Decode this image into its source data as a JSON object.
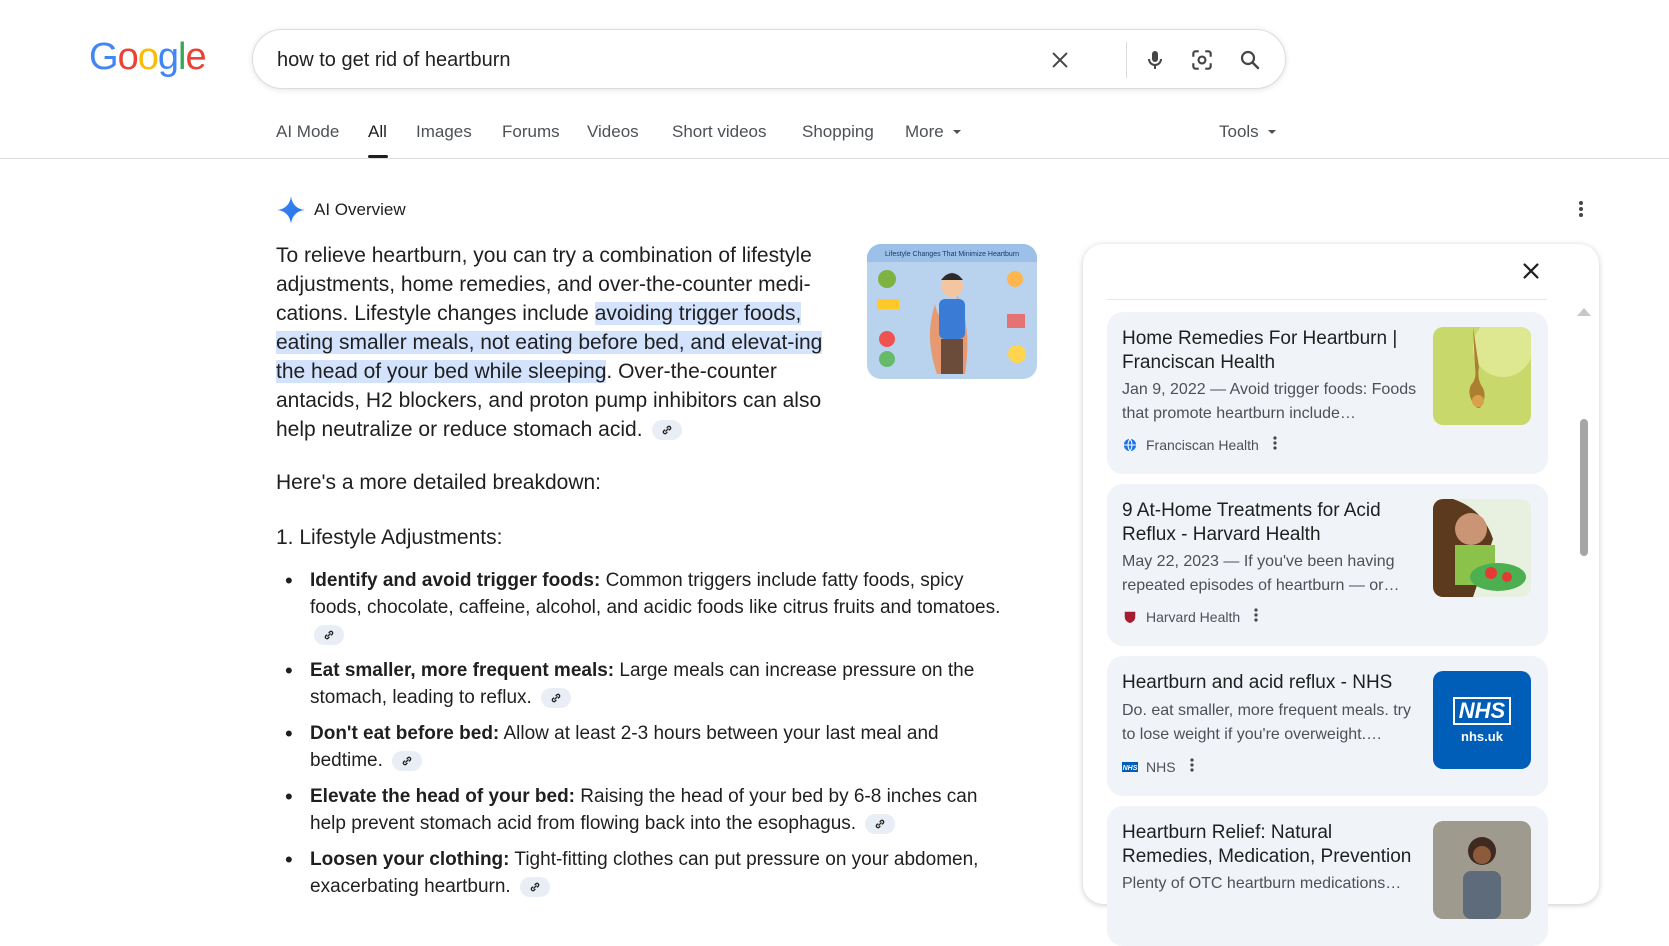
{
  "search": {
    "query": "how to get rid of heartburn"
  },
  "logo": {
    "letters": [
      "G",
      "o",
      "o",
      "g",
      "l",
      "e"
    ],
    "colors": [
      "#4285f4",
      "#ea4335",
      "#fbbc05",
      "#4285f4",
      "#34a853",
      "#ea4335"
    ]
  },
  "tabs": [
    {
      "label": "AI Mode"
    },
    {
      "label": "All"
    },
    {
      "label": "Images"
    },
    {
      "label": "Forums"
    },
    {
      "label": "Videos"
    },
    {
      "label": "Short videos"
    },
    {
      "label": "Shopping"
    },
    {
      "label": "More"
    }
  ],
  "tools_label": "Tools",
  "ai_overview": {
    "label": "AI Overview",
    "intro_1": "To relieve heartburn, you can try a combination of lifestyle adjustments, home remedies, and over-the-counter medi-cations. Lifestyle changes include ",
    "intro_highlight": "avoiding trigger foods, eating smaller meals, not eating before bed, and elevat-ing the head of your bed while sleeping",
    "intro_2": ". Over-the-counter antacids, H2 blockers, and proton pump inhibitors can also help neutralize or reduce stomach acid.",
    "image_caption": "Lifestyle Changes That Minimize Heartburn",
    "breakdown_heading": "Here's a more detailed breakdown:",
    "section_heading": "1. Lifestyle Adjustments:",
    "bullets": [
      {
        "bold": "Identify and avoid trigger foods:",
        "text": " Common triggers include fatty foods, spicy foods, chocolate, caffeine, alcohol, and acidic foods like citrus fruits and tomatoes."
      },
      {
        "bold": "Eat smaller, more frequent meals:",
        "text": " Large meals can increase pressure on the stomach, leading to reflux."
      },
      {
        "bold": "Don't eat before bed:",
        "text": " Allow at least 2-3 hours between your last meal and bedtime."
      },
      {
        "bold": "Elevate the head of your bed:",
        "text": " Raising the head of your bed by 6-8 inches can help prevent stomach acid from flowing back into the esophagus."
      },
      {
        "bold": "Loosen your clothing:",
        "text": " Tight-fitting clothes can put pressure on your abdomen, exacerbating heartburn."
      }
    ]
  },
  "sources": [
    {
      "title": "Home Remedies For Heartburn | Franciscan Health",
      "snippet": "Jan 9, 2022 — Avoid trigger foods: Foods that promote heartburn include…",
      "site": "Franciscan Health"
    },
    {
      "title": "9 At-Home Treatments for Acid Reflux - Harvard Health",
      "snippet": "May 22, 2023 — If you've been having repeated episodes of heartburn — or…",
      "site": "Harvard Health"
    },
    {
      "title": "Heartburn and acid reflux - NHS",
      "snippet": "Do. eat smaller, more frequent meals. try to lose weight if you're overweight.…",
      "site": "NHS",
      "thumb_logo": "NHS",
      "thumb_domain": "nhs.uk"
    },
    {
      "title": "Heartburn Relief: Natural Remedies, Medication, Prevention",
      "snippet": "Plenty of OTC heartburn medications…",
      "site": ""
    }
  ]
}
